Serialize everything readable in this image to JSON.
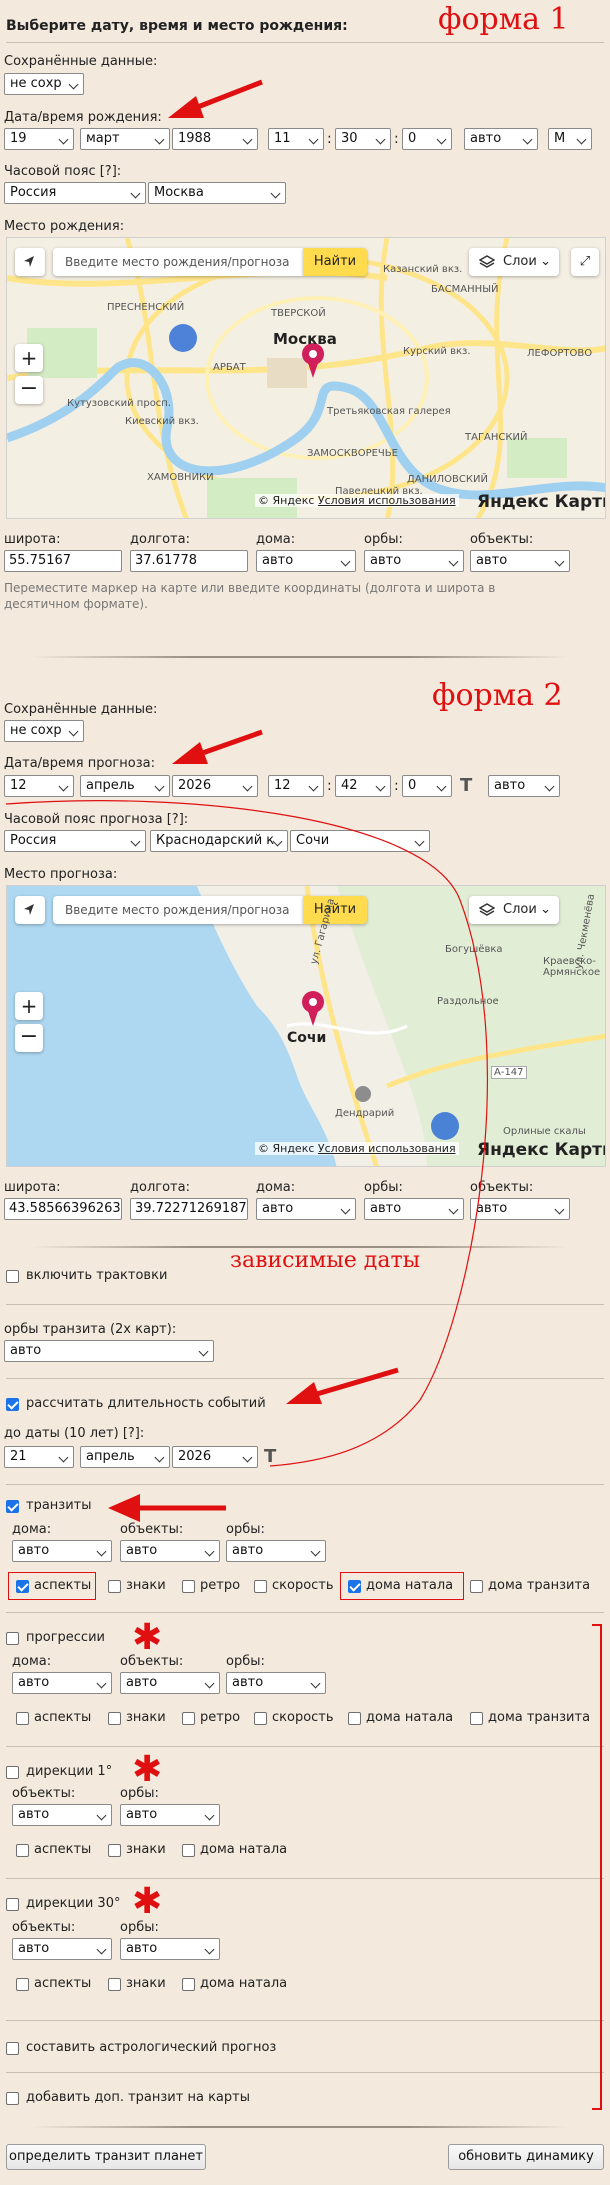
{
  "header": {
    "title": "Выберите дату, время и место рождения:"
  },
  "form1": {
    "annotation": "форма 1",
    "saved_label": "Сохранённые данные:",
    "saved_value": "не сохр",
    "datetime_label": "Дата/время рождения:",
    "day": "19",
    "month": "март",
    "year": "1988",
    "hour": "11",
    "minute": "30",
    "second": "0",
    "auto": "авто",
    "gender": "М",
    "tz_label": "Часовой пояс [?]:",
    "country": "Россия",
    "city": "Москва",
    "place_label": "Место рождения:",
    "lat_label": "широта:",
    "lon_label": "долгота:",
    "houses_label": "дома:",
    "orbs_label": "орбы:",
    "objects_label": "объекты:",
    "lat": "55.75167",
    "lon": "37.61778",
    "houses": "авто",
    "orbs": "авто",
    "objects": "авто",
    "hint": "Переместите маркер на карте или введите координаты (долгота и широта в десятичном формате)."
  },
  "map1": {
    "search_placeholder": "Введите место рождения/прогноза",
    "find": "Найти",
    "layers": "Слои",
    "copyright": "© Яндекс",
    "terms": "Условия использования",
    "logo": "Яндекс Карты",
    "labels": [
      "Казанский вкз.",
      "ТВЕРСКОЙ",
      "БАСМАННЫЙ",
      "ПРЕСНЕНСКИЙ",
      "Курский вкз.",
      "Москва",
      "ЛЕФОРТОВО",
      "АРБАТ",
      "Кутузовский просп.",
      "Третьяковская галерея",
      "Киевский вкз.",
      "ТАГАНСКИЙ",
      "ЗАМОСКВОРЕЧЬЕ",
      "ХАМОВНИКИ",
      "ДАНИЛОВСКИЙ",
      "Павелецкий вкз."
    ]
  },
  "form2": {
    "annotation": "форма 2",
    "saved_label": "Сохранённые данные:",
    "saved_value": "не сохр",
    "datetime_label": "Дата/время прогноза:",
    "day": "12",
    "month": "апрель",
    "year": "2026",
    "hour": "12",
    "minute": "42",
    "second": "0",
    "auto": "авто",
    "tz_label": "Часовой пояс прогноза [?]:",
    "country": "Россия",
    "region": "Краснодарский к",
    "city": "Сочи",
    "place_label": "Место прогноза:",
    "lat_label": "широта:",
    "lon_label": "долгота:",
    "houses_label": "дома:",
    "orbs_label": "орбы:",
    "objects_label": "объекты:",
    "lat": "43.58566396263",
    "lon": "39.72271269187",
    "houses": "авто",
    "orbs": "авто",
    "objects": "авто"
  },
  "map2": {
    "search_placeholder": "Введите место рождения/прогноза",
    "find": "Найти",
    "layers": "Слои",
    "copyright": "© Яндекс",
    "terms": "Условия использования",
    "logo": "Яндекс Карты",
    "labels": [
      "Богушёвка",
      "Краевско-Армянское",
      "Раздольное",
      "Сочи",
      "ул. Гагарина",
      "А-147",
      "ул. Чекменёва",
      "Дендрарий",
      "Орлиные скалы"
    ]
  },
  "annotations": {
    "dependent_dates": "зависимые даты"
  },
  "options": {
    "tractovki": "включить трактовки",
    "transit_orbs_label": "орбы транзита (2х карт):",
    "transit_orbs": "авто",
    "duration": "рассчитать длительность событий",
    "until_label": "до даты (10 лет) [?]:",
    "until_day": "21",
    "until_month": "апрель",
    "until_year": "2026"
  },
  "transits": {
    "label": "транзиты",
    "houses_label": "дома:",
    "objects_label": "объекты:",
    "orbs_label": "орбы:",
    "houses": "авто",
    "objects": "авто",
    "orbs": "авто",
    "checks": [
      "аспекты",
      "знаки",
      "ретро",
      "скорость",
      "дома натала",
      "дома транзита"
    ]
  },
  "progressions": {
    "label": "прогрессии",
    "houses_label": "дома:",
    "objects_label": "объекты:",
    "orbs_label": "орбы:",
    "houses": "авто",
    "objects": "авто",
    "orbs": "авто",
    "checks": [
      "аспекты",
      "знаки",
      "ретро",
      "скорость",
      "дома натала",
      "дома транзита"
    ]
  },
  "directions1": {
    "label": "дирекции 1°",
    "objects_label": "объекты:",
    "orbs_label": "орбы:",
    "objects": "авто",
    "orbs": "авто",
    "checks": [
      "аспекты",
      "знаки",
      "дома натала"
    ]
  },
  "directions30": {
    "label": "дирекции 30°",
    "objects_label": "объекты:",
    "orbs_label": "орбы:",
    "objects": "авто",
    "orbs": "авто",
    "checks": [
      "аспекты",
      "знаки",
      "дома натала"
    ]
  },
  "extra": {
    "forecast": "составить астрологический прогноз",
    "add_transit": "добавить доп. транзит на карты"
  },
  "buttons": {
    "transit": "определить транзит планет",
    "dynamics": "обновить динамику"
  },
  "colors": {
    "background": "#f3e9dd",
    "annotation_red": "#e01010",
    "checkbox_blue": "#1a73e8",
    "yandex_yellow": "#ffdb4d"
  }
}
